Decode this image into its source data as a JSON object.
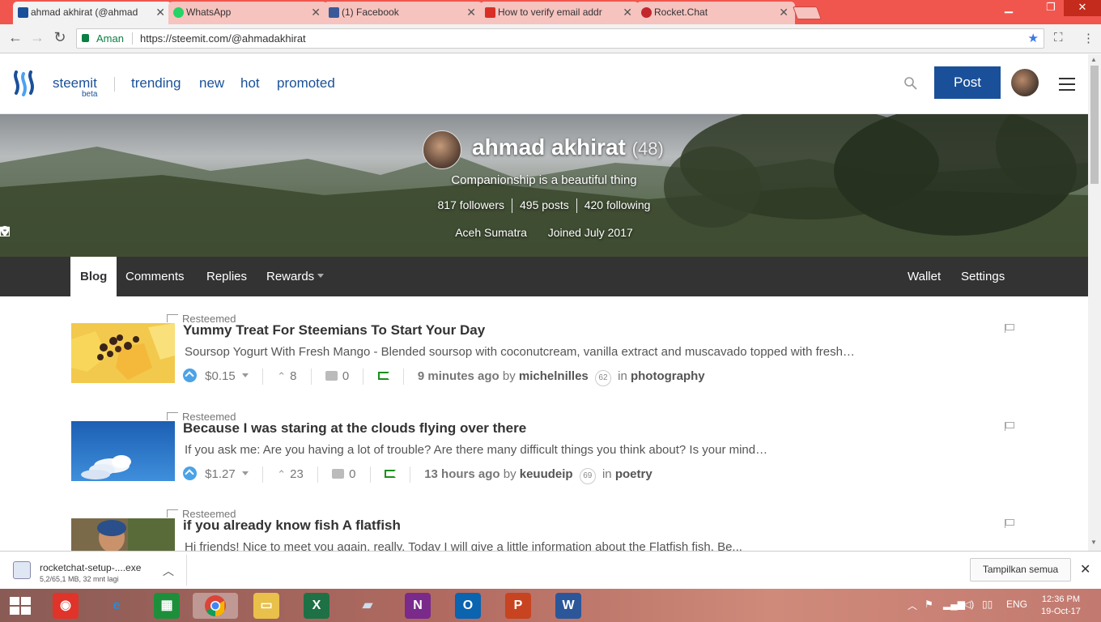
{
  "browser": {
    "tabs": [
      {
        "title": "ahmad akhirat (@ahmad",
        "color": "#1a5099",
        "active": true
      },
      {
        "title": "WhatsApp",
        "color": "#25d366",
        "active": false
      },
      {
        "title": "(1) Facebook",
        "color": "#3b5998",
        "active": false
      },
      {
        "title": "How to verify email addr",
        "color": "#d93025",
        "active": false
      },
      {
        "title": "Rocket.Chat",
        "color": "#c1272d",
        "active": false
      }
    ],
    "secure_label": "Aman",
    "url": "https://steemit.com/@ahmadakhirat"
  },
  "header": {
    "brand": "steemit",
    "beta": "beta",
    "nav": [
      "trending",
      "new",
      "hot",
      "promoted"
    ],
    "post_button": "Post"
  },
  "profile": {
    "name": "ahmad akhirat",
    "reputation": "(48)",
    "about": "Companionship is a beautiful thing",
    "followers": "817 followers",
    "posts": "495 posts",
    "following": "420 following",
    "location": "Aceh Sumatra",
    "joined": "Joined July 2017"
  },
  "profile_tabs": {
    "blog": "Blog",
    "comments": "Comments",
    "replies": "Replies",
    "rewards": "Rewards",
    "wallet": "Wallet",
    "settings": "Settings"
  },
  "posts": [
    {
      "resteemed": "Resteemed",
      "title": "Yummy Treat For Steemians To Start Your Day",
      "body": "Soursop Yogurt With Fresh Mango - Blended soursop with coconutcream,  vanilla extract and muscavado topped with fresh…",
      "payout": "$0.15",
      "votes": "8",
      "comments": "0",
      "time": "9 minutes ago",
      "by": "by",
      "author": "michelnilles",
      "rep": "62",
      "in": "in",
      "category": "photography"
    },
    {
      "resteemed": "Resteemed",
      "title": "Because I was staring at the clouds flying over there",
      "body": "If you ask me: Are you having a lot of trouble? Are there many difficult things you think about? Is your mind…",
      "payout": "$1.27",
      "votes": "23",
      "comments": "0",
      "time": "13 hours ago",
      "by": "by",
      "author": "keuudeip",
      "rep": "69",
      "in": "in",
      "category": "poetry"
    },
    {
      "resteemed": "Resteemed",
      "title": "if you already know fish A flatfish",
      "body": "Hi friends! Nice to meet you again, really. Today I will give a little information about the Flatfish fish. Be...",
      "payout": "",
      "votes": "",
      "comments": "",
      "time": "",
      "by": "",
      "author": "",
      "rep": "",
      "in": "",
      "category": ""
    }
  ],
  "download": {
    "filename": "rocketchat-setup-....exe",
    "progress": "5,2/65,1 MB, 32 mnt lagi",
    "show_all": "Tampilkan semua"
  },
  "taskbar": {
    "lang": "ENG",
    "time": "12:36 PM",
    "date": "19-Oct-17"
  }
}
